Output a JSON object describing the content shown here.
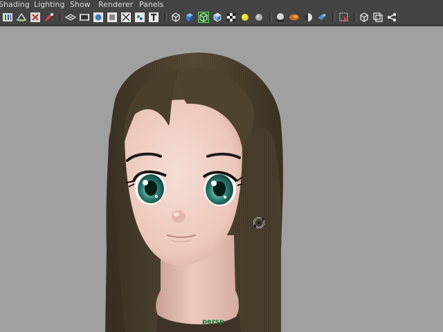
{
  "menu": {
    "items": [
      "Shading",
      "Lighting",
      "Show",
      "Renderer",
      "Panels"
    ]
  },
  "toolbar": {
    "icons": [
      "select-camera-icon",
      "camera-attributes-icon",
      "bookmarks-icon",
      "image-plane-icon",
      "grid-icon",
      "film-gate-icon",
      "resolution-gate-icon",
      "gate-mask-icon",
      "field-chart-icon",
      "safe-action-icon",
      "safe-title-icon",
      "wireframe-icon",
      "smooth-shade-icon",
      "wireframe-on-shaded-icon",
      "cube-icon",
      "textured-icon",
      "use-all-lights-icon",
      "shadows-icon",
      "screen-space-ao-icon",
      "motion-blur-icon",
      "anti-aliasing-icon",
      "depth-of-field-icon",
      "isolate-select-icon",
      "xray-icon",
      "xray-joints-icon",
      "share-icon"
    ]
  },
  "viewport": {
    "camera_label": "persp",
    "background_color": "#a0a0a0",
    "skin_color": "#f0cfc4",
    "hair_color": "#4a3f2d",
    "eye_color": "#2a7a6f"
  }
}
